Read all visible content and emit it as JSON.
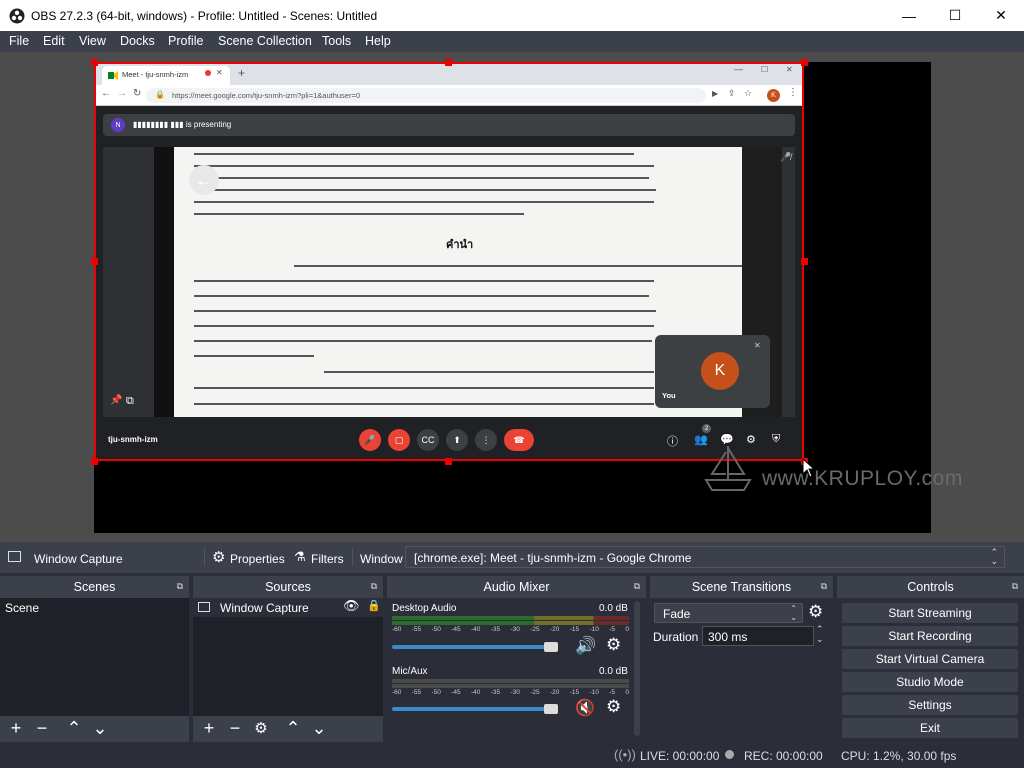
{
  "window": {
    "title": "OBS 27.2.3 (64-bit, windows) - Profile: Untitled - Scenes: Untitled"
  },
  "menu": [
    "File",
    "Edit",
    "View",
    "Docks",
    "Profile",
    "Scene Collection",
    "Tools",
    "Help"
  ],
  "browser": {
    "tab_title": "Meet - tju-snmh-izm",
    "url": "https://meet.google.com/tju-snmh-izm?pli=1&authuser=0",
    "profile_initial": "K"
  },
  "meet": {
    "presenter_initial": "N",
    "banner_text": "▮▮▮▮▮▮▮▮ ▮▮▮ is presenting",
    "meeting_code": "tju-snmh-izm",
    "self_label": "You",
    "self_initial": "K",
    "participants_count": "2",
    "doc_heading": "คำนำ"
  },
  "watermark": "www.KRUPLOY.com",
  "source_toolbar": {
    "source_name": "Window Capture",
    "properties": "Properties",
    "filters": "Filters",
    "window_label": "Window",
    "window_value": "[chrome.exe]: Meet - tju-snmh-izm - Google Chrome"
  },
  "scenes": {
    "title": "Scenes",
    "items": [
      "Scene"
    ]
  },
  "sources": {
    "title": "Sources",
    "items": [
      "Window Capture"
    ]
  },
  "mixer": {
    "title": "Audio Mixer",
    "ticks": [
      "-60",
      "-55",
      "-50",
      "-45",
      "-40",
      "-35",
      "-30",
      "-25",
      "-20",
      "-15",
      "-10",
      "-5",
      "0"
    ],
    "channels": [
      {
        "name": "Desktop Audio",
        "db": "0.0 dB",
        "volume_fraction": 0.68,
        "muted": false
      },
      {
        "name": "Mic/Aux",
        "db": "0.0 dB",
        "volume_fraction": 0.68,
        "muted": true
      }
    ]
  },
  "transitions": {
    "title": "Scene Transitions",
    "selected": "Fade",
    "duration_label": "Duration",
    "duration_value": "300 ms"
  },
  "controls": {
    "title": "Controls",
    "buttons": [
      "Start Streaming",
      "Start Recording",
      "Start Virtual Camera",
      "Studio Mode",
      "Settings",
      "Exit"
    ]
  },
  "status": {
    "live": "LIVE: 00:00:00",
    "rec": "REC: 00:00:00",
    "cpu": "CPU: 1.2%, 30.00 fps"
  },
  "colors": {
    "selection_red": "#ee0000",
    "obs_panel": "#2b2e38",
    "obs_header": "#3c404b",
    "meet_red": "#ea4335",
    "avatar": "#c5501a",
    "volume_blue": "#3a89c9"
  }
}
